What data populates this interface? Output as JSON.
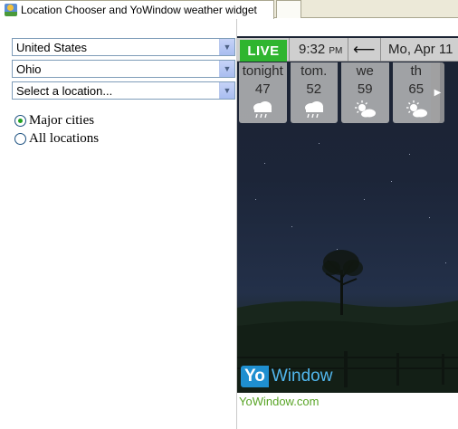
{
  "window": {
    "tab_title": "Location Chooser and YoWindow weather widget",
    "tab_icon": "weather-app-icon"
  },
  "chooser": {
    "country": "United States",
    "state": "Ohio",
    "location_placeholder": "Select a location...",
    "radio_major": "Major cities",
    "radio_all": "All locations",
    "selected_radio": "major"
  },
  "widget": {
    "live_label": "LIVE",
    "time": "9:32",
    "ampm": "PM",
    "date": "Mo, Apr 11",
    "forecast": [
      {
        "day": "tonight",
        "temp": "47",
        "icon": "rain-cloud-icon"
      },
      {
        "day": "tom.",
        "temp": "52",
        "icon": "rain-cloud-icon"
      },
      {
        "day": "we",
        "temp": "59",
        "icon": "sun-cloud-icon"
      },
      {
        "day": "th",
        "temp": "65",
        "icon": "sun-cloud-icon"
      }
    ],
    "logo_yo": "Yo",
    "logo_window": "Window",
    "link_text": "YoWindow.com"
  },
  "colors": {
    "live_green": "#2fb52f",
    "link_green": "#5aa528",
    "logo_blue": "#1f8fd0"
  }
}
